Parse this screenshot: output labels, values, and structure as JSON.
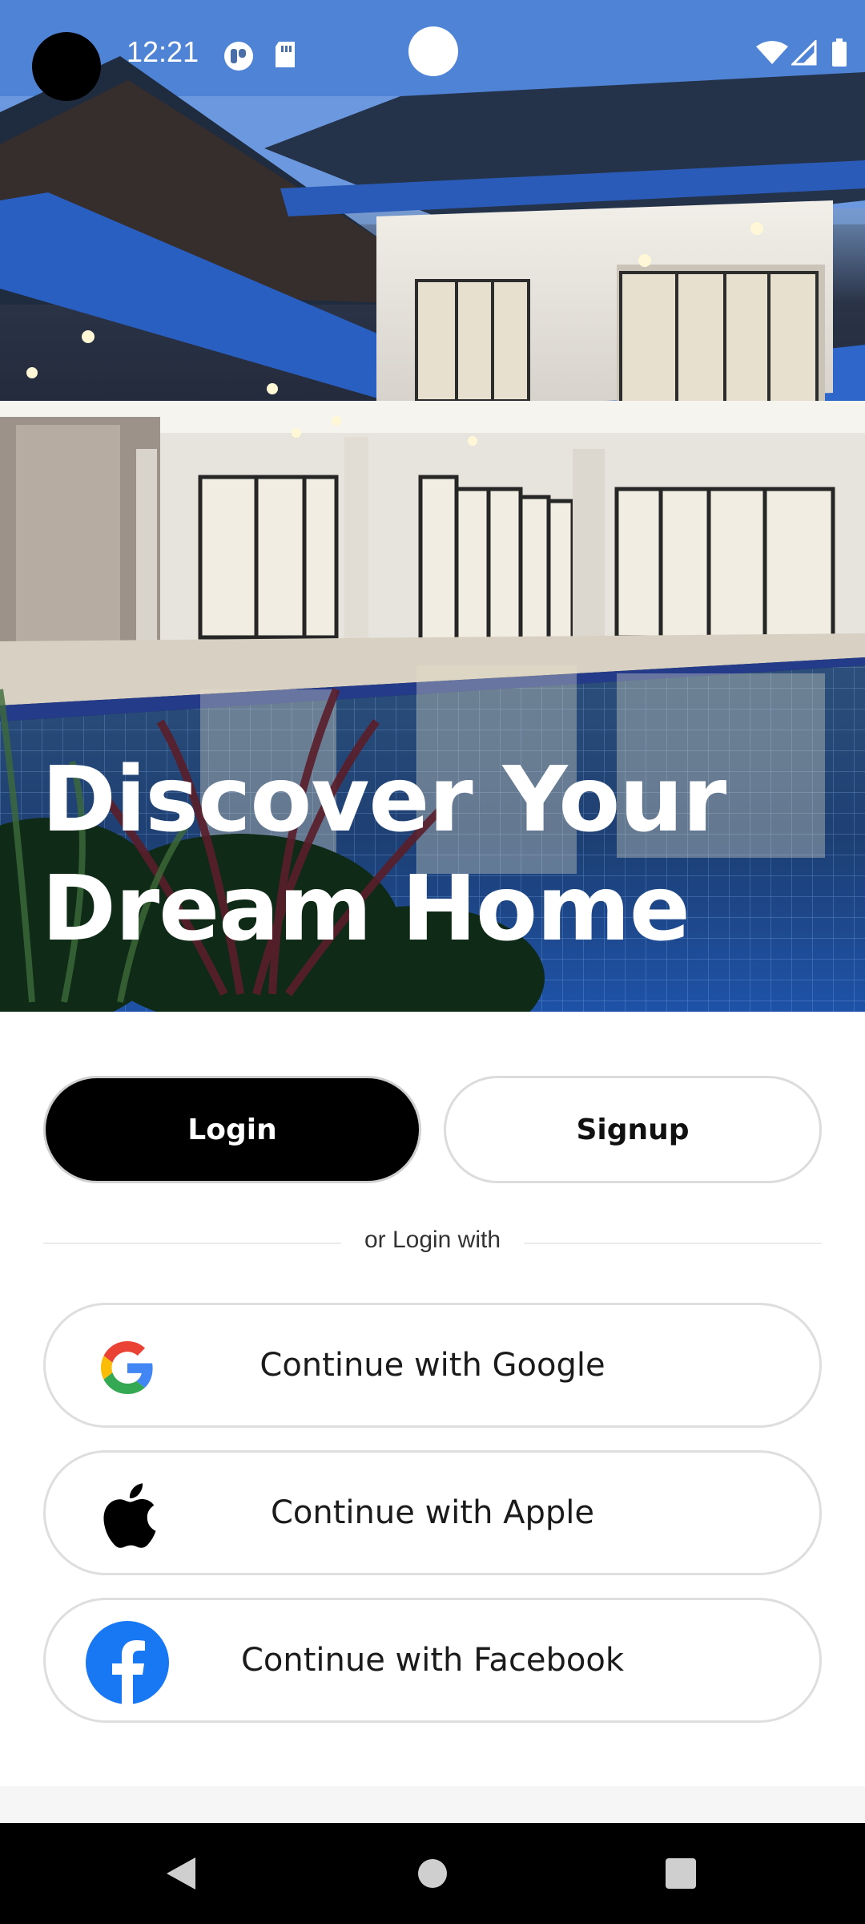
{
  "status_bar": {
    "time": "12:21",
    "icons": [
      "notification-app-icon",
      "sd-card-icon",
      "wifi-icon",
      "cell-signal-icon",
      "battery-icon"
    ]
  },
  "hero": {
    "title_line1": "Discover Your",
    "title_line2": "Dream Home",
    "image": "modern-villa-with-pool-photo"
  },
  "auth": {
    "login_label": "Login",
    "signup_label": "Signup",
    "divider_text": "or Login with"
  },
  "social": [
    {
      "label": "Continue with Google",
      "icon": "google-icon"
    },
    {
      "label": "Continue with Apple",
      "icon": "apple-icon"
    },
    {
      "label": "Continue with Facebook",
      "icon": "facebook-icon"
    }
  ],
  "nav_bar": {
    "buttons": [
      "back-icon",
      "home-icon",
      "recents-icon"
    ]
  },
  "colors": {
    "primary_button": "#000000",
    "facebook_blue": "#1877F2",
    "google_blue": "#4285F4",
    "google_red": "#EA4335",
    "google_yellow": "#FBBC05",
    "google_green": "#34A853"
  }
}
